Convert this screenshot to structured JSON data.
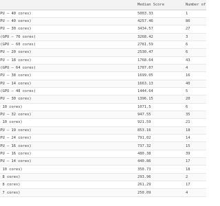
{
  "table": {
    "columns": [
      "",
      "Median Score",
      "Number of Be"
    ],
    "rows": [
      {
        "device": "ax (GPU — 40 cores)",
        "score": "5003.33",
        "count": "1"
      },
      {
        "device": "ax (GPU — 40 cores)",
        "score": "4257.46",
        "count": "86"
      },
      {
        "device": "ax (GPU — 30 cores)",
        "score": "3434.57",
        "count": "27"
      },
      {
        "device": "ltra (GPU — 76 cores)",
        "score": "3268.42",
        "count": "3"
      },
      {
        "device": "ltra (GPU — 60 cores)",
        "score": "2781.59",
        "count": "6"
      },
      {
        "device": "ro (GPU — 20 cores)",
        "score": "2530.47",
        "count": "6"
      },
      {
        "device": "ro (GPU — 18 cores)",
        "score": "1768.64",
        "count": "43"
      },
      {
        "device": "ltra (GPU — 64 cores)",
        "score": "1707.07",
        "count": "4"
      },
      {
        "device": "ax (GPU — 38 cores)",
        "score": "1699.05",
        "count": "16"
      },
      {
        "device": "ro (GPU — 14 cores)",
        "score": "1663.13",
        "count": "40"
      },
      {
        "device": "ltra (GPU — 48 cores)",
        "score": "1444.64",
        "count": "5"
      },
      {
        "device": "ax (GPU — 30 cores)",
        "score": "1396.15",
        "count": "20"
      },
      {
        "device": "GPU — 10 cores)",
        "score": "1071.5",
        "count": "6"
      },
      {
        "device": "ax (GPU — 32 cores)",
        "score": "947.55",
        "count": "35"
      },
      {
        "device": "GPU — 10 cores)",
        "score": "921.59",
        "count": "21"
      },
      {
        "device": "ro (GPU — 19 cores)",
        "score": "853.16",
        "count": "18"
      },
      {
        "device": "ax (GPU — 24 cores)",
        "score": "791.02",
        "count": "14"
      },
      {
        "device": "ro (GPU — 16 cores)",
        "score": "737.32",
        "count": "15"
      },
      {
        "device": "ro (GPU — 16 cores)",
        "score": "480.38",
        "count": "39"
      },
      {
        "device": "ro (GPU — 14 cores)",
        "score": "440.86",
        "count": "17"
      },
      {
        "device": "GPU — 10 cores)",
        "score": "350.73",
        "count": "18"
      },
      {
        "device": "GPU — 8 cores)",
        "score": "293.96",
        "count": "2"
      },
      {
        "device": "GPU — 8 cores)",
        "score": "261.29",
        "count": "17"
      },
      {
        "device": "GPU — 7 cores)",
        "score": "250.09",
        "count": "4"
      }
    ]
  }
}
